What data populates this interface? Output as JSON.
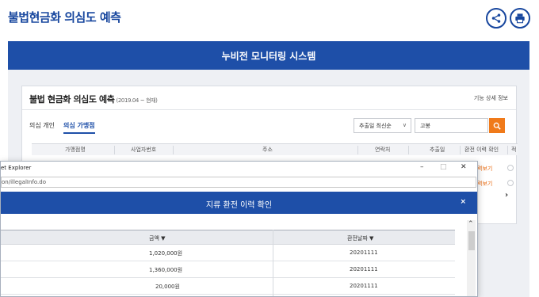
{
  "page": {
    "title": "불법현금화 의심도 예측"
  },
  "header_actions": [
    {
      "name": "share",
      "icon": "share-icon"
    },
    {
      "name": "print",
      "icon": "print-icon"
    }
  ],
  "banner": {
    "title": "누비전 모니터링 시스템"
  },
  "card": {
    "title": "불법 현금화 의심도 예측",
    "period": "(2019.04 ~ 현재)",
    "detail_link": "기능 상세 정보",
    "tabs": [
      {
        "label": "의심 개인",
        "active": false
      },
      {
        "label": "의심 가맹점",
        "active": true
      }
    ],
    "sort": {
      "value": "추출일 최신순"
    },
    "search": {
      "value": "고봉"
    },
    "table": {
      "headers": [
        "가맹점명",
        "사업자번호",
        "주소",
        "연락처",
        "추출일",
        "환전 이력 확인",
        "적"
      ],
      "row_links": [
        "력보기",
        "력보기"
      ]
    }
  },
  "popup": {
    "window_title": "et Explorer",
    "url": "on/illegalInfo.do",
    "header_title": "지류 환전 이력 확인",
    "close_label": "×",
    "table": {
      "headers": [
        "금액 ▼",
        "환전날짜 ▼"
      ],
      "rows": [
        {
          "amount": "1,020,000원",
          "date": "20201111"
        },
        {
          "amount": "1,360,000원",
          "date": "20201111"
        },
        {
          "amount": "20,000원",
          "date": "20201111"
        }
      ]
    }
  },
  "colors": {
    "brand_blue": "#1e4fa8",
    "accent_orange": "#f07a1a"
  }
}
